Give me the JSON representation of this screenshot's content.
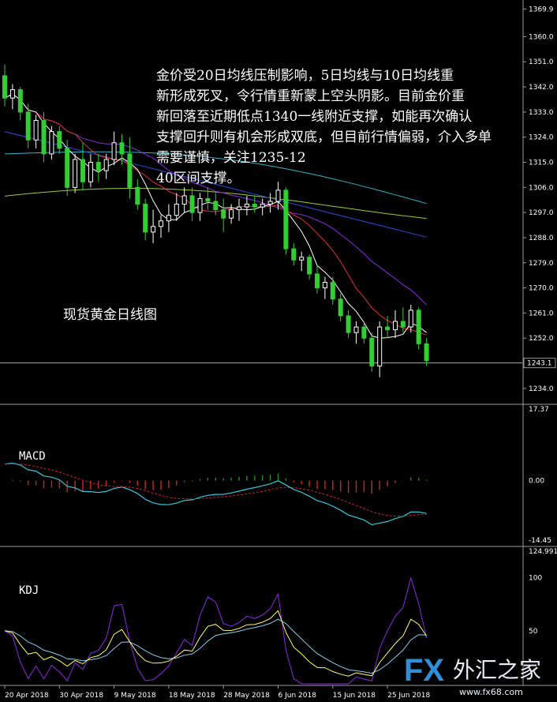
{
  "chart_data": [
    {
      "type": "candlestick",
      "title": "现货黄金日线图",
      "ylim": [
        1230,
        1372
      ],
      "y_ticks": [
        "1369.9",
        "1360.0",
        "1351.0",
        "1342.0",
        "1333.0",
        "1324.0",
        "1315.0",
        "1306.0",
        "1297.0",
        "1288.0",
        "1279.0",
        "1270.0",
        "1261.0",
        "1252.0",
        "1243.0",
        "1234.0"
      ],
      "current_price": "1243.1",
      "x_ticks": [
        "20 Apr 2018",
        "30 Apr 2018",
        "9 May 2018",
        "18 May 2018",
        "28 May 2018",
        "6 Jun 2018",
        "15 Jun 2018",
        "25 Jun 2018"
      ],
      "annotation": "金价受20日均线压制影响，5日均线与10日均线重新形成死叉，令行情重新蒙上空头阴影。目前金价重新回落至近期低点1340一线附近支撑，如能再次确认支撑回升则有机会形成双底，但目前行情偏弱，介入多单需要谨慎，关注1235-1240区间支撑。",
      "candles": [
        [
          1346,
          1350,
          1335,
          1338
        ],
        [
          1338,
          1343,
          1334,
          1341
        ],
        [
          1341,
          1342,
          1330,
          1333
        ],
        [
          1333,
          1336,
          1320,
          1323
        ],
        [
          1323,
          1332,
          1320,
          1330
        ],
        [
          1330,
          1333,
          1315,
          1318
        ],
        [
          1318,
          1328,
          1316,
          1326
        ],
        [
          1326,
          1328,
          1318,
          1320
        ],
        [
          1320,
          1323,
          1303,
          1306
        ],
        [
          1306,
          1318,
          1304,
          1316
        ],
        [
          1316,
          1322,
          1305,
          1308
        ],
        [
          1308,
          1318,
          1306,
          1315
        ],
        [
          1315,
          1318,
          1308,
          1312
        ],
        [
          1312,
          1318,
          1309,
          1316
        ],
        [
          1316,
          1326,
          1314,
          1322
        ],
        [
          1322,
          1325,
          1314,
          1318
        ],
        [
          1318,
          1324,
          1302,
          1306
        ],
        [
          1306,
          1309,
          1298,
          1300
        ],
        [
          1300,
          1302,
          1287,
          1290
        ],
        [
          1290,
          1298,
          1286,
          1292
        ],
        [
          1292,
          1296,
          1288,
          1294
        ],
        [
          1294,
          1300,
          1290,
          1296
        ],
        [
          1296,
          1304,
          1294,
          1300
        ],
        [
          1300,
          1306,
          1297,
          1303
        ],
        [
          1303,
          1306,
          1294,
          1297
        ],
        [
          1297,
          1304,
          1294,
          1302
        ],
        [
          1302,
          1306,
          1298,
          1301
        ],
        [
          1301,
          1304,
          1296,
          1298
        ],
        [
          1298,
          1302,
          1290,
          1295
        ],
        [
          1295,
          1300,
          1293,
          1298
        ],
        [
          1298,
          1302,
          1294,
          1299
        ],
        [
          1299,
          1303,
          1296,
          1300
        ],
        [
          1300,
          1303,
          1297,
          1299
        ],
        [
          1299,
          1302,
          1296,
          1300
        ],
        [
          1300,
          1304,
          1297,
          1301
        ],
        [
          1301,
          1308,
          1298,
          1305
        ],
        [
          1305,
          1306,
          1282,
          1284
        ],
        [
          1284,
          1286,
          1278,
          1280
        ],
        [
          1280,
          1283,
          1276,
          1281
        ],
        [
          1281,
          1282,
          1273,
          1275
        ],
        [
          1275,
          1278,
          1268,
          1270
        ],
        [
          1270,
          1274,
          1266,
          1272
        ],
        [
          1272,
          1274,
          1264,
          1266
        ],
        [
          1266,
          1268,
          1258,
          1260
        ],
        [
          1260,
          1262,
          1252,
          1254
        ],
        [
          1254,
          1258,
          1250,
          1256
        ],
        [
          1256,
          1258,
          1250,
          1252
        ],
        [
          1252,
          1254,
          1240,
          1242
        ],
        [
          1242,
          1258,
          1238,
          1256
        ],
        [
          1256,
          1260,
          1252,
          1255
        ],
        [
          1255,
          1262,
          1252,
          1258
        ],
        [
          1258,
          1263,
          1254,
          1256
        ],
        [
          1256,
          1264,
          1254,
          1262
        ],
        [
          1262,
          1263,
          1248,
          1250
        ],
        [
          1250,
          1252,
          1242,
          1244
        ]
      ],
      "ma_colors": {
        "ma5": "#ffffff",
        "ma10": "#e23232",
        "ma20": "#8a2be2",
        "ma_blue": "#2a4de0",
        "ma_cyan": "#36b3c4",
        "ma_green": "#9acd32"
      },
      "up_color": "#ffffff",
      "down_color": "#32cd32"
    },
    {
      "type": "bar",
      "title": "MACD",
      "ylim": [
        -14.45,
        17.37
      ],
      "y_ticks": [
        "17.37",
        "0.00",
        "-14.45"
      ],
      "colors": {
        "hist_pos": "#2e8b2e",
        "hist_neg": "#c82828",
        "macd": "#36c8d8",
        "signal": "#c82828"
      }
    },
    {
      "type": "line",
      "title": "KDJ",
      "ylim": [
        0,
        124.9914
      ],
      "y_ticks": [
        "124.9914",
        "100",
        "50"
      ],
      "colors": {
        "k": "#ffff66",
        "d": "#87ceeb",
        "j": "#8a2be2"
      }
    }
  ],
  "watermark": {
    "fx": "FX",
    "cn": "外汇之家",
    "url": "www.fx68.com"
  }
}
